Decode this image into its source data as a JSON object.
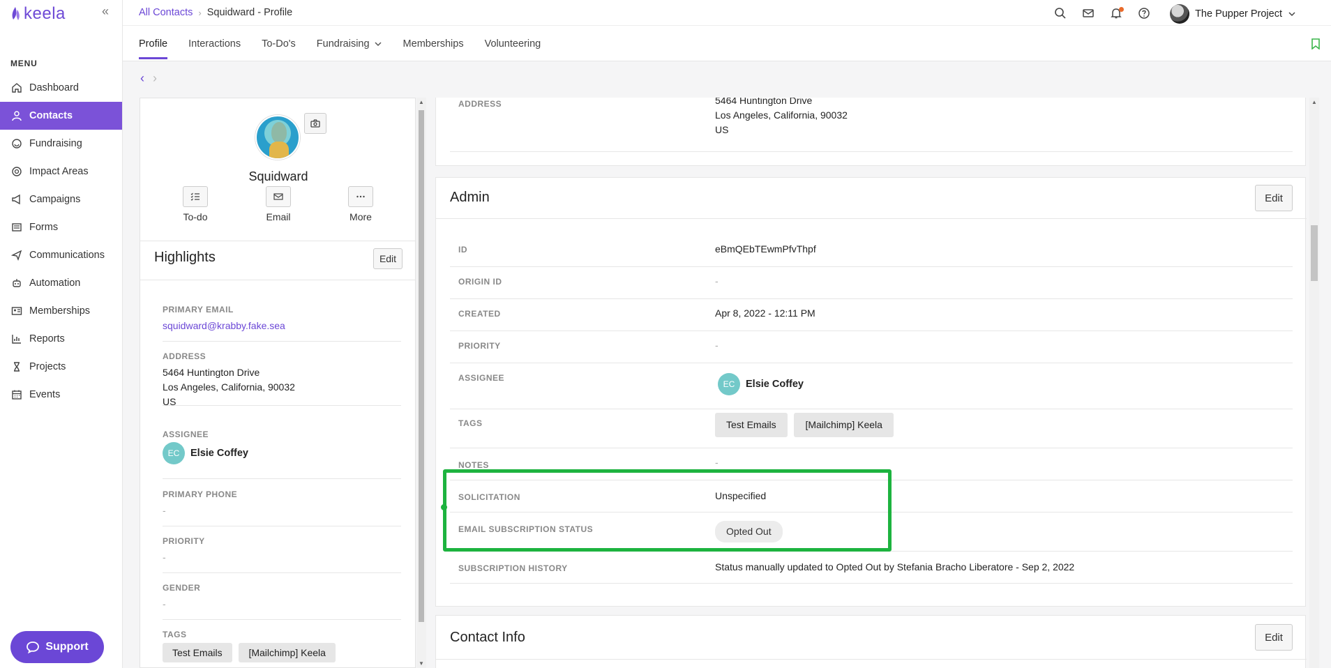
{
  "app": {
    "logo_text": "keela",
    "collapse_icon": "double-chevron-left-icon"
  },
  "sidebar": {
    "menu_title": "MENU",
    "items": [
      {
        "label": "Dashboard",
        "icon": "home-icon",
        "active": false
      },
      {
        "label": "Contacts",
        "icon": "person-icon",
        "active": true
      },
      {
        "label": "Fundraising",
        "icon": "donation-icon",
        "active": false
      },
      {
        "label": "Impact Areas",
        "icon": "impact-icon",
        "active": false
      },
      {
        "label": "Campaigns",
        "icon": "megaphone-icon",
        "active": false
      },
      {
        "label": "Forms",
        "icon": "form-icon",
        "active": false
      },
      {
        "label": "Communications",
        "icon": "send-icon",
        "active": false
      },
      {
        "label": "Automation",
        "icon": "robot-icon",
        "active": false
      },
      {
        "label": "Memberships",
        "icon": "id-card-icon",
        "active": false
      },
      {
        "label": "Reports",
        "icon": "chart-icon",
        "active": false
      },
      {
        "label": "Projects",
        "icon": "hourglass-icon",
        "active": false
      },
      {
        "label": "Events",
        "icon": "calendar-icon",
        "active": false
      }
    ],
    "support_label": "Support"
  },
  "header": {
    "breadcrumb": {
      "parent": "All Contacts",
      "current": "Squidward - Profile"
    },
    "org_name": "The Pupper Project"
  },
  "tabs": [
    {
      "label": "Profile",
      "active": true
    },
    {
      "label": "Interactions",
      "active": false
    },
    {
      "label": "To-Do's",
      "active": false
    },
    {
      "label": "Fundraising",
      "active": false,
      "dropdown": true
    },
    {
      "label": "Memberships",
      "active": false
    },
    {
      "label": "Volunteering",
      "active": false
    }
  ],
  "profile": {
    "name": "Squidward",
    "actions": [
      {
        "label": "To-do",
        "icon": "checklist-icon"
      },
      {
        "label": "Email",
        "icon": "envelope-icon"
      },
      {
        "label": "More",
        "icon": "ellipsis-icon"
      }
    ]
  },
  "highlights": {
    "title": "Highlights",
    "edit_label": "Edit",
    "primary_email_label": "PRIMARY EMAIL",
    "primary_email": "squidward@krabby.fake.sea",
    "address_label": "ADDRESS",
    "address_lines": [
      "5464 Huntington Drive",
      "Los Angeles, California, 90032",
      "US"
    ],
    "assignee_label": "ASSIGNEE",
    "assignee_initials": "EC",
    "assignee_name": "Elsie Coffey",
    "primary_phone_label": "PRIMARY PHONE",
    "primary_phone": "-",
    "priority_label": "PRIORITY",
    "priority": "-",
    "gender_label": "GENDER",
    "gender": "-",
    "tags_label": "TAGS",
    "tags": [
      "Test Emails",
      "[Mailchimp] Keela"
    ]
  },
  "address_card": {
    "label": "ADDRESS",
    "lines": [
      "5464 Huntington Drive",
      "Los Angeles, California, 90032",
      "US"
    ]
  },
  "admin": {
    "title": "Admin",
    "edit_label": "Edit",
    "id_label": "ID",
    "id": "eBmQEbTEwmPfvThpf",
    "origin_id_label": "ORIGIN ID",
    "origin_id": "-",
    "created_label": "CREATED",
    "created": "Apr 8, 2022 - 12:11 PM",
    "priority_label": "PRIORITY",
    "priority": "-",
    "assignee_label": "ASSIGNEE",
    "assignee_initials": "EC",
    "assignee_name": "Elsie Coffey",
    "tags_label": "TAGS",
    "tags": [
      "Test Emails",
      "[Mailchimp] Keela"
    ],
    "notes_label": "NOTES",
    "notes": "-",
    "solicitation_label": "SOLICITATION",
    "solicitation": "Unspecified",
    "email_status_label": "EMAIL SUBSCRIPTION STATUS",
    "email_status": "Opted Out",
    "subscription_history_label": "SUBSCRIPTION HISTORY",
    "subscription_history": "Status manually updated to Opted Out by Stefania Bracho Liberatore - Sep 2, 2022"
  },
  "contact_info": {
    "title": "Contact Info",
    "edit_label": "Edit"
  },
  "colors": {
    "accent": "#6b47d6",
    "active_nav": "#7b52d8",
    "highlight_box": "#1db33f",
    "notif_dot": "#e96a2a"
  }
}
